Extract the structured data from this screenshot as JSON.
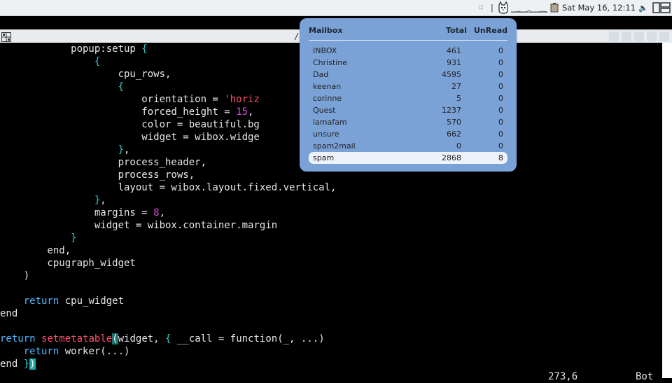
{
  "topbar": {
    "clock": "Sat May 16, 12:11",
    "icons": [
      "tag-icon",
      "separator",
      "cat-icon",
      "cpu-graph",
      "battery-icon",
      "volume-icon",
      "layout-icon"
    ],
    "separator": "|",
    "volume_glyph": "🔈"
  },
  "titlebar": {
    "title": "/"
  },
  "editor": {
    "colors": {
      "keyword": "#4db9ff",
      "function": "#ff4f6a",
      "number": "#d64ad6",
      "brace": "#33c8d0",
      "cursor": "#1fa7a7"
    },
    "lines": [
      [
        [
          "",
          "            popup:setup "
        ],
        [
          "p",
          "{"
        ]
      ],
      [
        [
          "",
          "                "
        ],
        [
          "p",
          "{"
        ]
      ],
      [
        [
          "",
          "                    cpu_rows,"
        ]
      ],
      [
        [
          "",
          "                    "
        ],
        [
          "p",
          "{"
        ]
      ],
      [
        [
          "",
          "                        orientation = "
        ],
        [
          "s",
          "'horiz"
        ]
      ],
      [
        [
          "",
          "                        forced_height = "
        ],
        [
          "n",
          "15"
        ],
        [
          "",
          ","
        ]
      ],
      [
        [
          "",
          "                        color = beautiful.bg"
        ]
      ],
      [
        [
          "",
          "                        widget = wibox.widge"
        ]
      ],
      [
        [
          "",
          "                    "
        ],
        [
          "p",
          "}"
        ],
        [
          "",
          ","
        ]
      ],
      [
        [
          "",
          "                    process_header,"
        ]
      ],
      [
        [
          "",
          "                    process_rows,"
        ]
      ],
      [
        [
          "",
          "                    layout = wibox.layout.fixed.vertical,"
        ]
      ],
      [
        [
          "",
          "                "
        ],
        [
          "p",
          "}"
        ],
        [
          "",
          ","
        ]
      ],
      [
        [
          "",
          "                margins = "
        ],
        [
          "n",
          "8"
        ],
        [
          "",
          ","
        ]
      ],
      [
        [
          "",
          "                widget = wibox.container.margin"
        ]
      ],
      [
        [
          "",
          "            "
        ],
        [
          "p",
          "}"
        ]
      ],
      [
        [
          "",
          "        end,"
        ]
      ],
      [
        [
          "",
          "        cpugraph_widget"
        ]
      ],
      [
        [
          "",
          "    )"
        ]
      ],
      [
        [
          "",
          ""
        ]
      ],
      [
        [
          "",
          "    "
        ],
        [
          "k",
          "return"
        ],
        [
          "",
          " cpu_widget"
        ]
      ],
      [
        [
          "",
          "end"
        ]
      ],
      [
        [
          "",
          ""
        ]
      ],
      [
        [
          "k",
          "return"
        ],
        [
          "",
          " "
        ],
        [
          "f",
          "setmetatable"
        ],
        [
          "hl",
          "("
        ],
        [
          "",
          "widget, "
        ],
        [
          "p",
          "{"
        ],
        [
          "",
          " __call = function(_, ...)"
        ]
      ],
      [
        [
          "",
          "    "
        ],
        [
          "k",
          "return"
        ],
        [
          "",
          " worker(...)"
        ]
      ],
      [
        [
          "",
          "end "
        ],
        [
          "p",
          "}"
        ],
        [
          "cursor",
          ")"
        ]
      ]
    ],
    "status": {
      "position": "273,6",
      "scroll": "Bot"
    }
  },
  "mailbox": {
    "headers": {
      "name": "Mailbox",
      "total": "Total",
      "unread": "UnRead"
    },
    "rows": [
      {
        "name": "INBOX",
        "total": "461",
        "unread": "0"
      },
      {
        "name": "Christine",
        "total": "931",
        "unread": "0"
      },
      {
        "name": "Dad",
        "total": "4595",
        "unread": "0"
      },
      {
        "name": "keenan",
        "total": "27",
        "unread": "0"
      },
      {
        "name": "corinne",
        "total": "5",
        "unread": "0"
      },
      {
        "name": "Quest",
        "total": "1237",
        "unread": "0"
      },
      {
        "name": "lamafam",
        "total": "570",
        "unread": "0"
      },
      {
        "name": "unsure",
        "total": "662",
        "unread": "0"
      },
      {
        "name": "spam2mail",
        "total": "0",
        "unread": "0"
      },
      {
        "name": "spam",
        "total": "2868",
        "unread": "8",
        "selected": true
      }
    ]
  }
}
